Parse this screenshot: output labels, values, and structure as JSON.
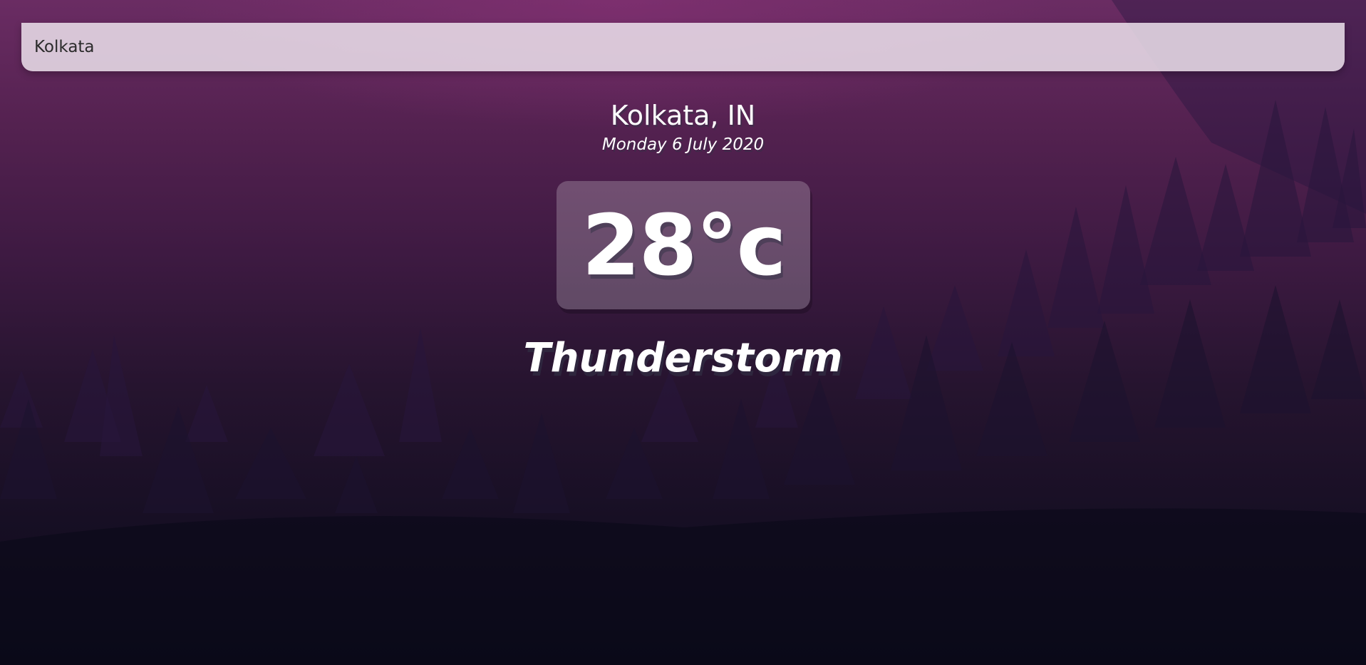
{
  "search": {
    "value": "Kolkata"
  },
  "location": {
    "city_country": "Kolkata, IN",
    "date": "Monday 6 July 2020"
  },
  "weather": {
    "temperature": "28°c",
    "condition": "Thunderstorm"
  },
  "colors": {
    "background_top": "#6a2c63",
    "background_bottom": "#0c0b1a",
    "search_bg": "#ebe1eb",
    "text": "#ffffff"
  },
  "icons": {
    "background": "forest-trees-illustration"
  }
}
